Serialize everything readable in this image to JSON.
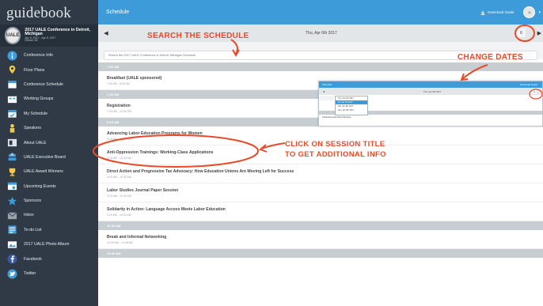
{
  "brand": {
    "name": "guidebook"
  },
  "guide": {
    "title": "2017 UALE Conference in Detroit, Michigan",
    "dates": "Apr 6, 2017 - Apr 8, 2017",
    "location": "Detroit, MI"
  },
  "sidebar": {
    "items": [
      {
        "label": "Conference Info",
        "icon": "info-icon",
        "color": "#3c9bd8"
      },
      {
        "label": "Floor Plans",
        "icon": "map-pin-icon",
        "color": "#f2c94c"
      },
      {
        "label": "Conference Schedule",
        "icon": "calendar-icon",
        "color": "#3c9bd8"
      },
      {
        "label": "Working Groups",
        "icon": "groups-icon",
        "color": "#3c9bd8"
      },
      {
        "label": "My Schedule",
        "icon": "my-calendar-icon",
        "color": "#3c9bd8"
      },
      {
        "label": "Speakers",
        "icon": "speaker-icon",
        "color": "#f2c94c"
      },
      {
        "label": "About UALE",
        "icon": "about-icon",
        "color": "#dfe5ea"
      },
      {
        "label": "UALE Executive Board",
        "icon": "board-icon",
        "color": "#3c9bd8"
      },
      {
        "label": "UALE Award Winners",
        "icon": "trophy-icon",
        "color": "#f2c94c"
      },
      {
        "label": "Upcoming Events",
        "icon": "events-icon",
        "color": "#3c9bd8"
      },
      {
        "label": "Sponsors",
        "icon": "star-icon",
        "color": "#3c9bd8"
      },
      {
        "label": "Inbox",
        "icon": "inbox-icon",
        "color": "#9aa3ab"
      },
      {
        "label": "To-do List",
        "icon": "todo-icon",
        "color": "#3c9bd8"
      },
      {
        "label": "2017 UALE Photo Album",
        "icon": "photo-icon",
        "color": "#3c9bd8"
      },
      {
        "label": "Facebook",
        "icon": "facebook-icon",
        "color": "#3b5998"
      },
      {
        "label": "Twitter",
        "icon": "twitter-icon",
        "color": "#3c9bd8"
      }
    ]
  },
  "topbar": {
    "title": "Schedule",
    "download_label": "Download Guide"
  },
  "datebar": {
    "date": "Thu, Apr 6th 2017",
    "calendar_label": "6"
  },
  "search": {
    "placeholder": "Search the 2017 UALE Conference in Detroit, Michigan Schedule"
  },
  "schedule": {
    "groups": [
      {
        "time": "7:00 AM",
        "sessions": [
          {
            "title": "Breakfast (UALE sponsored)",
            "time": "7:00 AM - 8:00 AM"
          }
        ]
      },
      {
        "time": "7:30 AM",
        "sessions": [
          {
            "title": "Registration",
            "time": "7:30 AM - 12:00 PM"
          }
        ]
      },
      {
        "time": "9:15 AM",
        "sessions": [
          {
            "title": "Advancing Labor Education Programs for Women",
            "time": "9:15 AM - 10:30 AM"
          },
          {
            "title": "Anti-Oppression Trainings: Working-Class Applications",
            "time": "9:15 AM - 10:30 AM"
          },
          {
            "title": "Direct Action and Progressive Tax Advocacy: How Education Unions Are Moving Left for Success",
            "time": "9:15 AM - 10:30 AM"
          },
          {
            "title": "Labor Studies Journal Paper Session",
            "time": "9:15 AM - 10:30 AM"
          },
          {
            "title": "Solidarity in Action: Language Access Meets Labor Education",
            "time": "9:15 AM - 10:30 AM"
          }
        ]
      },
      {
        "time": "10:30 AM",
        "sessions": [
          {
            "title": "Break and Informal Networking",
            "time": "10:30 AM - 10:45 AM"
          }
        ]
      },
      {
        "time": "10:45 AM",
        "sessions": []
      }
    ]
  },
  "inset": {
    "title": "Schedule",
    "download_label": "Download Guide",
    "date": "Thu, Apr 6th 2017",
    "calendar_label": "6",
    "options": [
      "Thu, Apr 6th 2017",
      "Fri, Apr 7th 2017",
      "Sat, Apr 8th 2017",
      "Sun, Apr 9th 2017"
    ],
    "row": "UALE Executive Board Meeting"
  },
  "annotations": {
    "search": "SEARCH THE SCHEDULE",
    "dates": "CHANGE DATES",
    "session_line1": "CLICK ON SESSION TITLE",
    "session_line2": "TO GET ADDITIONAL INFO",
    "color": "#e74b2a"
  }
}
